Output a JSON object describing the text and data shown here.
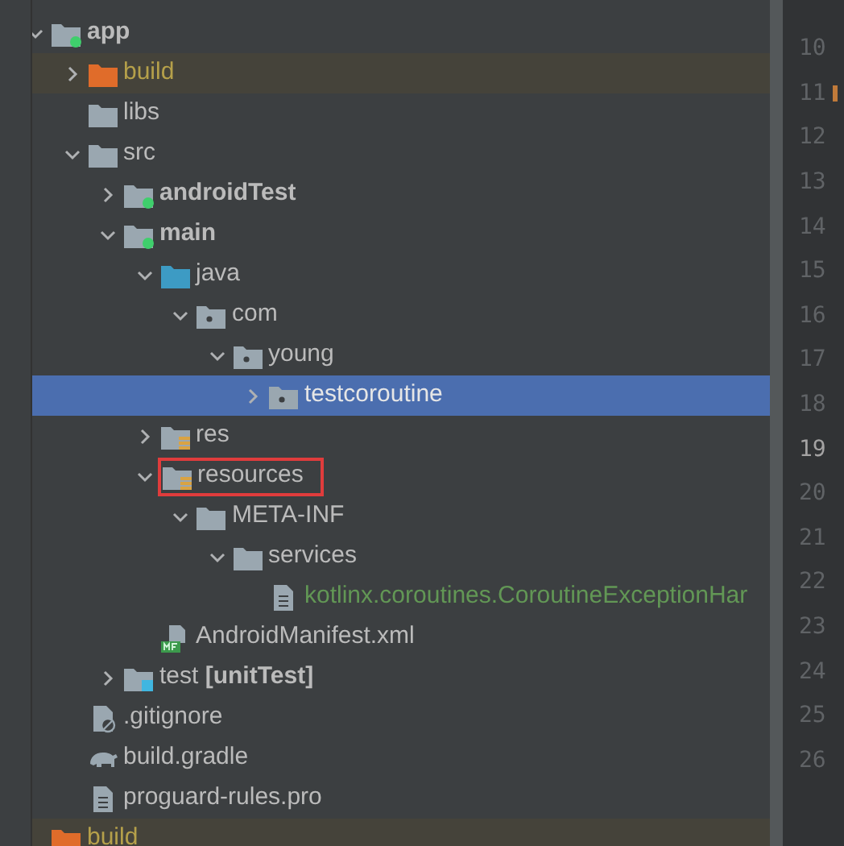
{
  "tree": [
    {
      "label": "app",
      "kind": "module",
      "bold": true,
      "expanded": true,
      "children": [
        {
          "label": "build",
          "kind": "excluded-folder",
          "expanded": false
        },
        {
          "label": "libs",
          "kind": "folder"
        },
        {
          "label": "src",
          "kind": "folder",
          "expanded": true,
          "children": [
            {
              "label": "androidTest",
              "kind": "module",
              "bold": true,
              "expanded": false
            },
            {
              "label": "main",
              "kind": "module",
              "bold": true,
              "expanded": true,
              "children": [
                {
                  "label": "java",
                  "kind": "source-folder",
                  "expanded": true,
                  "children": [
                    {
                      "label": "com",
                      "kind": "package",
                      "expanded": true,
                      "children": [
                        {
                          "label": "young",
                          "kind": "package",
                          "expanded": true,
                          "children": [
                            {
                              "label": "testcoroutine",
                              "kind": "package",
                              "selected": true,
                              "expanded": false
                            }
                          ]
                        }
                      ]
                    }
                  ]
                },
                {
                  "label": "res",
                  "kind": "resource-folder",
                  "expanded": false
                },
                {
                  "label": "resources",
                  "kind": "resource-folder",
                  "outlined": true,
                  "expanded": true,
                  "children": [
                    {
                      "label": "META-INF",
                      "kind": "folder",
                      "expanded": true,
                      "children": [
                        {
                          "label": "services",
                          "kind": "folder",
                          "expanded": true,
                          "children": [
                            {
                              "label": "kotlinx.coroutines.CoroutineExceptionHar",
                              "kind": "added-file"
                            }
                          ]
                        }
                      ]
                    }
                  ]
                },
                {
                  "label": "AndroidManifest.xml",
                  "kind": "manifest"
                }
              ]
            },
            {
              "label": "test **[unitTest]**",
              "kind": "test-folder",
              "expanded": false
            }
          ]
        },
        {
          "label": ".gitignore",
          "kind": "ignore-file"
        },
        {
          "label": "build.gradle",
          "kind": "gradle"
        },
        {
          "label": "proguard-rules.pro",
          "kind": "file"
        }
      ]
    },
    {
      "label": "build",
      "kind": "excluded-folder"
    }
  ],
  "line_numbers": [
    {
      "number": "10",
      "current": false,
      "changed": false
    },
    {
      "number": "11",
      "current": false,
      "changed": true
    },
    {
      "number": "12",
      "current": false,
      "changed": false
    },
    {
      "number": "13",
      "current": false,
      "changed": false
    },
    {
      "number": "14",
      "current": false,
      "changed": false
    },
    {
      "number": "15",
      "current": false,
      "changed": false
    },
    {
      "number": "16",
      "current": false,
      "changed": false
    },
    {
      "number": "17",
      "current": false,
      "changed": false
    },
    {
      "number": "18",
      "current": false,
      "changed": false
    },
    {
      "number": "19",
      "current": true,
      "changed": false
    },
    {
      "number": "20",
      "current": false,
      "changed": false
    },
    {
      "number": "21",
      "current": false,
      "changed": false
    },
    {
      "number": "22",
      "current": false,
      "changed": false
    },
    {
      "number": "23",
      "current": false,
      "changed": false
    },
    {
      "number": "24",
      "current": false,
      "changed": false
    },
    {
      "number": "25",
      "current": false,
      "changed": false
    },
    {
      "number": "26",
      "current": false,
      "changed": false
    }
  ]
}
